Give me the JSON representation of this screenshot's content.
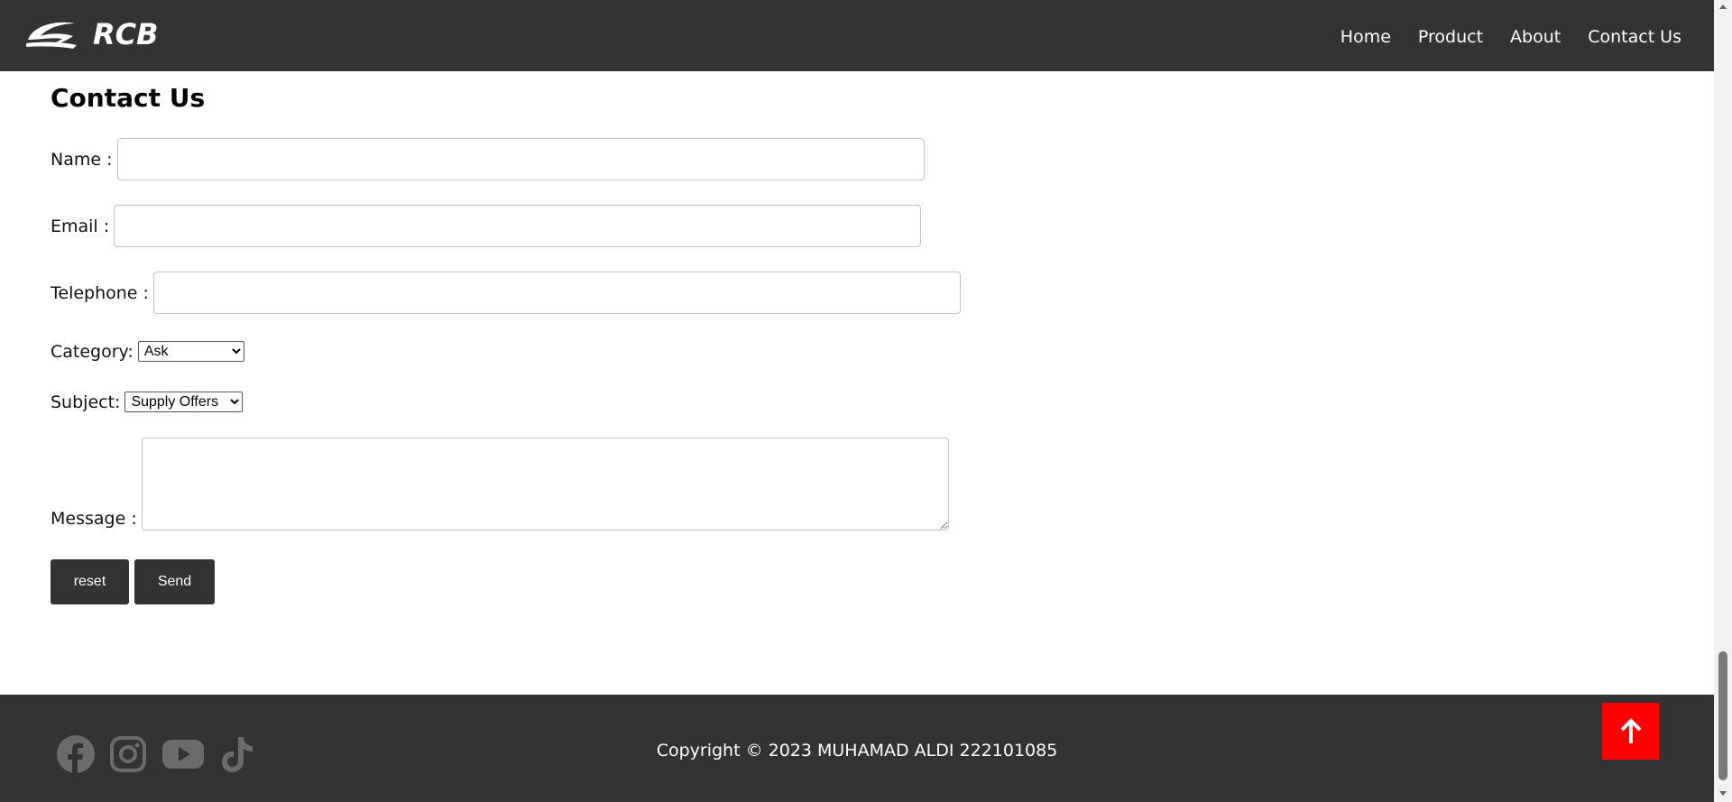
{
  "header": {
    "logo_text": "RCB",
    "nav": [
      "Home",
      "Product",
      "About",
      "Contact Us"
    ]
  },
  "form": {
    "title": "Contact Us",
    "name_label": "Name :",
    "name_value": "",
    "email_label": "Email :",
    "email_value": "",
    "telephone_label": "Telephone :",
    "telephone_value": "",
    "category_label": "Category:",
    "category_selected": "Ask",
    "subject_label": "Subject:",
    "subject_selected": "Supply Offers",
    "message_label": "Message :",
    "message_value": "",
    "reset_label": "reset",
    "send_label": "Send"
  },
  "footer": {
    "copyright": "Copyright © 2023 MUHAMAD ALDI 222101085",
    "social_icons": [
      "facebook-icon",
      "instagram-icon",
      "youtube-icon",
      "tiktok-icon"
    ],
    "scroll_top_icon": "arrow-up-icon"
  },
  "colors": {
    "header_bg": "#333333",
    "footer_bg": "#333333",
    "button_bg": "#333333",
    "scroll_top_bg": "#ff0000",
    "social_icon": "#6b6b6b"
  }
}
